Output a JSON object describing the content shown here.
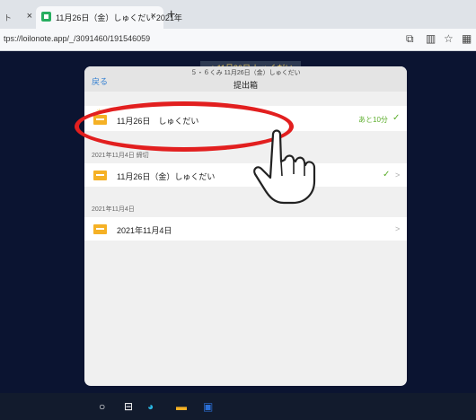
{
  "browser": {
    "tab_left": {
      "title": "ト",
      "close": "×"
    },
    "tab_active": {
      "title": "11月26日（金）しゅくだい 2021年",
      "close": "×"
    },
    "new_tab": "+",
    "url": "tps://loilonote.app/_/3091460/191546059"
  },
  "page": {
    "header_strip_text": "✓ 11月26日 しゅくだい",
    "modal": {
      "back_label": "戻る",
      "subtitle": "５・６くみ 11月26日（金）しゅくだい",
      "title": "提出箱",
      "rows": [
        {
          "section": "",
          "label": "11月26日　しゅくだい",
          "status": "あと10分",
          "check": "✓",
          "chevron": ""
        },
        {
          "section": "2021年11月4日 締切",
          "label": "11月26日（金）しゅくだい",
          "status": "",
          "check": "✓",
          "chevron": ">"
        },
        {
          "section": "2021年11月4日",
          "label": "2021年11月4日",
          "status": "",
          "check": "",
          "chevron": ">"
        }
      ]
    }
  },
  "taskbar": {
    "icons": [
      "search-icon",
      "task-view-icon",
      "edge-icon",
      "explorer-icon",
      "word-icon"
    ]
  },
  "colors": {
    "background": "#0b1431",
    "highlight": "#e21f1f",
    "accent_green": "#5cae2c",
    "link_blue": "#2e7dd1",
    "folder_yellow": "#f5b125"
  }
}
